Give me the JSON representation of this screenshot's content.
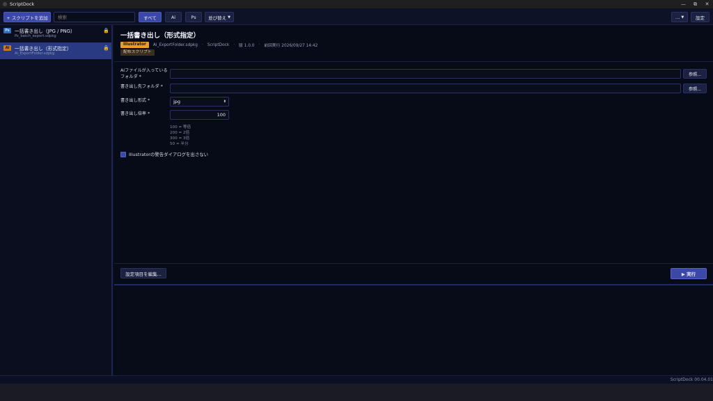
{
  "window": {
    "title": "ScriptDock",
    "minimize": "—",
    "maximize": "⧉",
    "close": "✕"
  },
  "toolbar": {
    "add_label": "+ スクリプトを追加",
    "search_placeholder": "検索",
    "filter_all": "すべて",
    "filter_ai": "Ai",
    "filter_ps": "Ps",
    "sort_label": "並び替え",
    "more_label": "…",
    "settings_label": "設定"
  },
  "sidebar": {
    "items": [
      {
        "badge": "Ps",
        "title": "一括書き出し（JPG / PNG）",
        "file": "Ps_batch_export.sdpkg",
        "locked": "🔒"
      },
      {
        "badge": "Ai",
        "title": "一括書き出し（形式指定）",
        "file": "Ai_ExportFolder.sdpkg",
        "locked": "🔒"
      }
    ]
  },
  "detail": {
    "title": "一括書き出し（形式指定）",
    "app_tag": "Illustrator",
    "file": "Ai_ExportFolder.sdpkg",
    "author": "ScriptDock",
    "version": "版 1.0.0",
    "last_run": "前回実行 2026/09/27 14:42",
    "dist_tag": "配布スクリプト",
    "sep": "·"
  },
  "form": {
    "input_folder_label_1": "AIファイルが入っている",
    "input_folder_label_2": "フォルダ *",
    "input_folder_value": "",
    "output_folder_label": "書き出し先フォルダ *",
    "output_folder_value": "",
    "browse_label": "参照...",
    "format_label": "書き出し形式 *",
    "format_value": "jpg",
    "scale_label": "書き出し倍率 *",
    "scale_value": "100",
    "scale_hints": [
      "100 = 等倍",
      "200 = 2倍",
      "300 = 3倍",
      "50 = 半分"
    ],
    "suppress_dialog_label": "Illustratorの警告ダイアログを出さない",
    "suppress_dialog_checked": true,
    "edit_settings_label": "設定項目を編集...",
    "run_label": "▶ 実行"
  },
  "status": {
    "version": "ScriptDock 00.04.01"
  },
  "colors": {
    "accent": "#3b48a7",
    "active_item": "#293a82",
    "illustrator": "#e89d2b",
    "photoshop": "#2f6fba"
  }
}
